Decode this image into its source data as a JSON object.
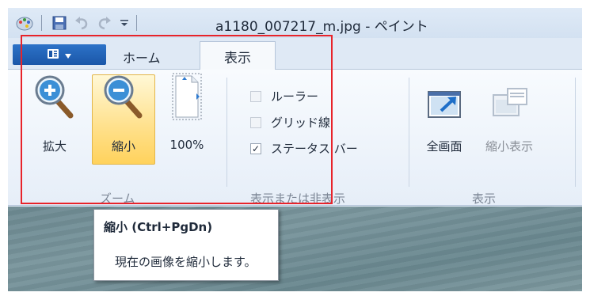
{
  "window": {
    "title": "a1180_007217_m.jpg - ペイント"
  },
  "quick_access": {
    "icons": [
      "paint-app-icon",
      "save-icon",
      "undo-icon",
      "redo-icon",
      "customize-dropdown-icon"
    ]
  },
  "tabs": {
    "file_menu_icon": "ribbon-menu-icon",
    "home": "ホーム",
    "view": "表示",
    "active": "表示"
  },
  "ribbon": {
    "zoom_group": {
      "label": "ズーム",
      "zoom_in": "拡大",
      "zoom_out": "縮小",
      "hundred_percent": "100%"
    },
    "show_hide_group": {
      "label": "表示または非表示",
      "ruler": {
        "label": "ルーラー",
        "checked": false
      },
      "gridlines": {
        "label": "グリッド線",
        "checked": false
      },
      "status_bar": {
        "label": "ステータス バー",
        "checked": true
      }
    },
    "display_group": {
      "label": "表示",
      "full_screen": "全画面",
      "thumbnail": "縮小表示"
    }
  },
  "tooltip": {
    "title": "縮小 (Ctrl+PgDn)",
    "description": "現在の画像を縮小します。"
  },
  "colors": {
    "highlight_border": "#e8232a",
    "file_tab": "#1a56a8",
    "hover_fill": "#ffe08a"
  }
}
